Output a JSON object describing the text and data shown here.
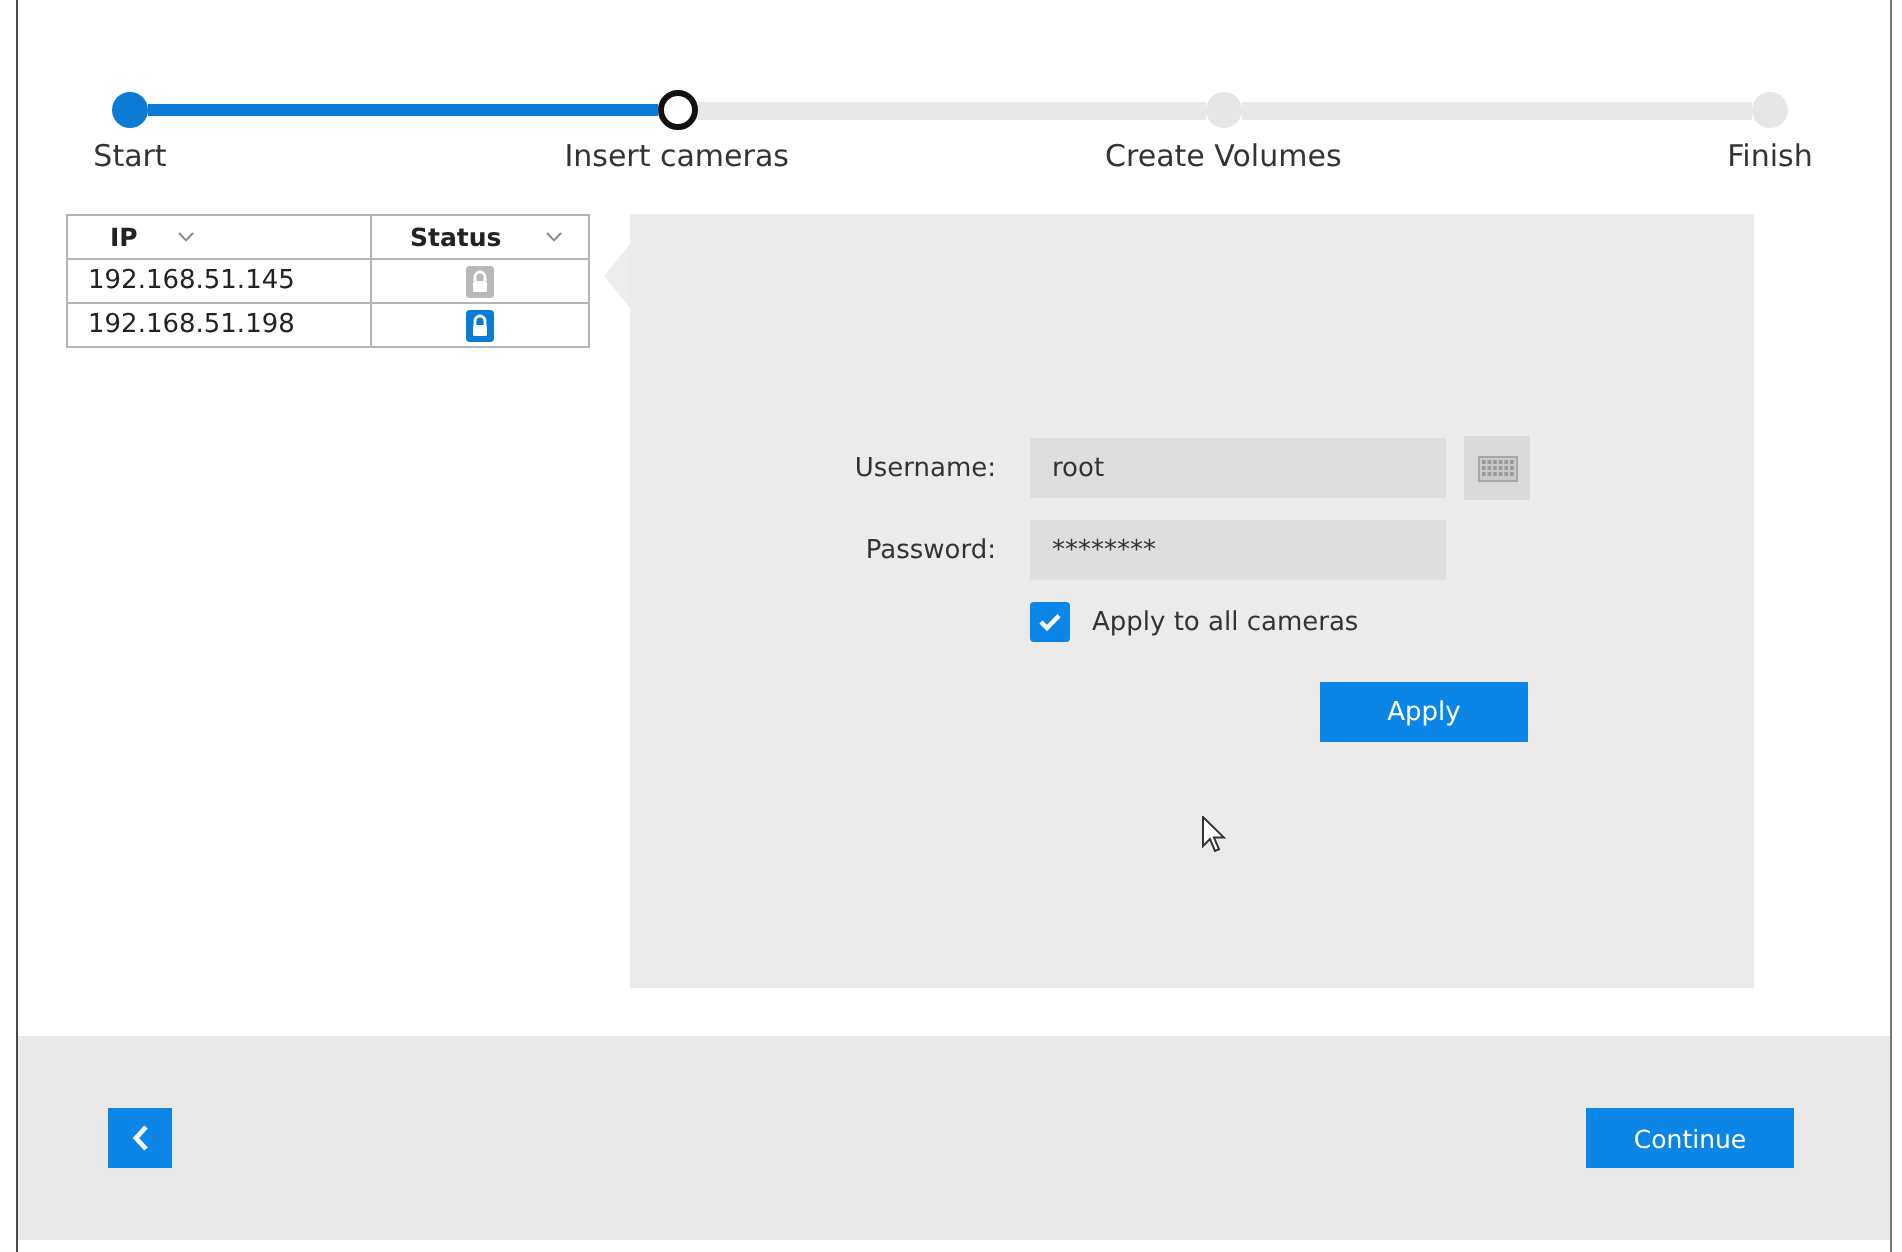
{
  "steps": [
    {
      "label": "Start",
      "completed": true,
      "selected": false
    },
    {
      "label": "Insert cameras",
      "completed": false,
      "selected": true
    },
    {
      "label": "Create Volumes",
      "completed": false,
      "selected": false
    },
    {
      "label": "Finish",
      "completed": false,
      "selected": false
    }
  ],
  "camera_table": {
    "columns": [
      "IP",
      "Status"
    ],
    "rows": [
      {
        "ip": "192.168.51.145",
        "authenticated": false
      },
      {
        "ip": "192.168.51.198",
        "authenticated": true
      }
    ]
  },
  "credentials_form": {
    "fields": [
      {
        "label": "Username:",
        "value": "root",
        "keyboard_button": true
      },
      {
        "label": "Password:",
        "value": "********",
        "keyboard_button": false
      }
    ],
    "apply_to_all": {
      "label": "Apply to all cameras",
      "checked": true
    },
    "apply_button": "Apply"
  },
  "footer": {
    "continue_button": "Continue"
  }
}
